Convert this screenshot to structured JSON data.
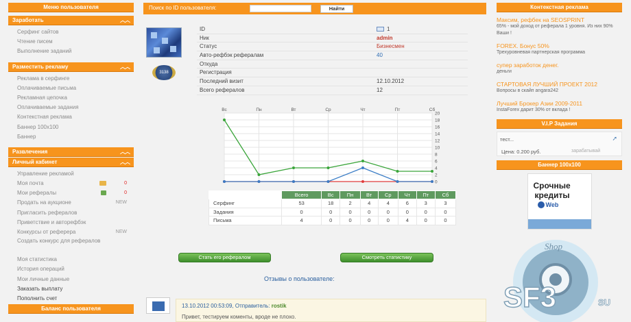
{
  "left": {
    "header": "Меню пользователя",
    "sections": [
      {
        "title": "Заработать",
        "items": [
          {
            "label": "Серфинг сайтов"
          },
          {
            "label": "Чтение писем"
          },
          {
            "label": "Выполнение заданий"
          }
        ]
      },
      {
        "title": "Разместить рекламу",
        "items": [
          {
            "label": "Реклама в серфинге"
          },
          {
            "label": "Оплачиваемые письма"
          },
          {
            "label": "Рекламная цепочка"
          },
          {
            "label": "Оплачиваемые задания"
          },
          {
            "label": "Контекстная реклама"
          },
          {
            "label": "Баннер 100x100"
          },
          {
            "label": "Баннер"
          }
        ]
      },
      {
        "title": "Развлечения",
        "items": []
      },
      {
        "title": "Личный кабинет",
        "items": [
          {
            "label": "Управление рекламой"
          },
          {
            "label": "Моя почта",
            "count": "0"
          },
          {
            "label": "Мои рефералы",
            "count": "0"
          },
          {
            "label": "Продать на аукционе",
            "badge": "NEW"
          },
          {
            "label": "Пригласить рефералов"
          },
          {
            "label": "Приветствие и авторефбэк"
          },
          {
            "label": "Конкурсы от реферера",
            "badge": "NEW"
          },
          {
            "label": "Создать конкурс для рефералов"
          },
          {
            "label": "Моя статистика"
          },
          {
            "label": "История операций"
          },
          {
            "label": "Мои личные данные"
          },
          {
            "label": "Заказать выплату"
          },
          {
            "label": "Пополнить счет"
          }
        ]
      }
    ],
    "balance_header": "Баланс пользователя"
  },
  "search": {
    "label": "Поиск по ID пользователя:",
    "value": "",
    "button": "Найти"
  },
  "profile": {
    "medal_text": "3138",
    "rows": [
      {
        "key": "ID",
        "value": "1"
      },
      {
        "key": "Ник",
        "value": "admin"
      },
      {
        "key": "Статус",
        "value": "Бизнесмен"
      },
      {
        "key": "Авто-рефбэк рефералам",
        "value": "40"
      },
      {
        "key": "Откуда",
        "value": ""
      },
      {
        "key": "Регистрация",
        "value": ""
      },
      {
        "key": "Последний визит",
        "value": "12.10.2012"
      },
      {
        "key": "Всего рефералов",
        "value": "12"
      }
    ]
  },
  "chart_data": {
    "type": "line",
    "categories": [
      "Вс",
      "Пн",
      "Вт",
      "Ср",
      "Чт",
      "Пт",
      "Сб"
    ],
    "ylim": [
      0,
      20
    ],
    "yticks": [
      0,
      2,
      4,
      6,
      8,
      10,
      12,
      14,
      16,
      18,
      20
    ],
    "series": [
      {
        "key": "surf",
        "color": "#3aa53a",
        "values": [
          18,
          2,
          4,
          4,
          6,
          3,
          3
        ]
      },
      {
        "key": "tasks",
        "color": "#e03c3c",
        "values": [
          0,
          0,
          0,
          0,
          0,
          0,
          0
        ]
      },
      {
        "key": "letters",
        "color": "#3b7dc6",
        "values": [
          0,
          0,
          0,
          0,
          4,
          0,
          0
        ]
      }
    ]
  },
  "stats_table": {
    "headers": [
      "Всего",
      "Вс",
      "Пн",
      "Вт",
      "Ср",
      "Чт",
      "Пт",
      "Сб"
    ],
    "rows": [
      {
        "label": "Серфинг",
        "values": [
          "53",
          "18",
          "2",
          "4",
          "4",
          "6",
          "3",
          "3"
        ]
      },
      {
        "label": "Задания",
        "values": [
          "0",
          "0",
          "0",
          "0",
          "0",
          "0",
          "0",
          "0"
        ]
      },
      {
        "label": "Письма",
        "values": [
          "4",
          "0",
          "0",
          "0",
          "0",
          "4",
          "0",
          "0"
        ]
      }
    ]
  },
  "buttons": {
    "become_referral": "Стать его рефералом",
    "view_stats": "Смотреть статистику"
  },
  "reviews": {
    "title": "Отзывы о пользователе:",
    "items": [
      {
        "header": "13.10.2012 00:53:09, Отправитель:",
        "author": "rostik",
        "text": "Привет, тестируем коменты, вроде не плохо."
      }
    ]
  },
  "right": {
    "context_header": "Контекстная реклама",
    "ads": [
      {
        "title": "Максим, рефбек на SEOSPRINT",
        "text": "65% - мой доход от реферала 1 уровня. Из них 90% Ваши !"
      },
      {
        "title": "FOREX. Бонус 50%",
        "text": "Трехуровневая партнерская программа"
      },
      {
        "title": "супер заработок денег.",
        "text": "деньги"
      },
      {
        "title": "СТАРТОВАЯ ЛУЧШИЙ ПРОЕКТ 2012",
        "text": "Вопросы в скайп angara242"
      },
      {
        "title": "Лучший Брокер Азии 2009-2011",
        "text": "InstaForex дарит 30% от вклада !"
      }
    ],
    "vip_header": "V.I.P Задания",
    "vip": {
      "title": "тест...",
      "price": "Цена: 0.200 руб.",
      "extra": "зарабатывай"
    },
    "banner_header": "Баннер 100x100",
    "banner": {
      "line1": "Срочные",
      "line2": "кредиты",
      "line3": "Web"
    }
  },
  "watermark": {
    "text": "SF3",
    "suffix": "SU",
    "shop": "Shop"
  }
}
